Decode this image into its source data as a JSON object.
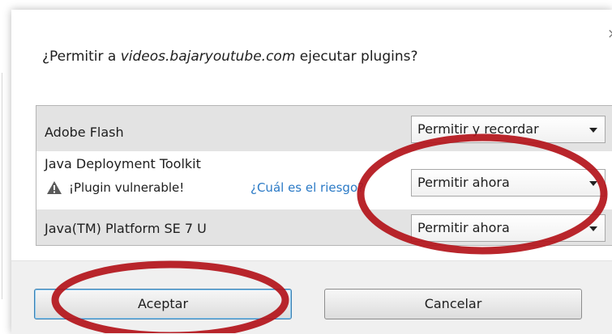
{
  "dialog": {
    "question_prefix": "¿Permitir a ",
    "question_domain": "videos.bajaryoutube.com",
    "question_suffix": " ejecutar plugins?",
    "close_symbol": "×"
  },
  "plugins": [
    {
      "name": "Adobe Flash",
      "permission": "Permitir y recordar"
    },
    {
      "name": "Java Deployment Toolkit",
      "warning": "¡Plugin vulnerable!",
      "risk_link": "¿Cuál es el riesgo?",
      "permission": "Permitir ahora"
    },
    {
      "name": "Java(TM) Platform SE 7 U",
      "permission": "Permitir ahora"
    }
  ],
  "buttons": {
    "accept": "Aceptar",
    "cancel": "Cancelar"
  },
  "colors": {
    "annotation_red": "#b3131a",
    "link_blue": "#2b7ac6"
  },
  "icons": {
    "warning": "warning-triangle-icon",
    "close": "close-icon",
    "dropdown": "chevron-down-icon"
  }
}
